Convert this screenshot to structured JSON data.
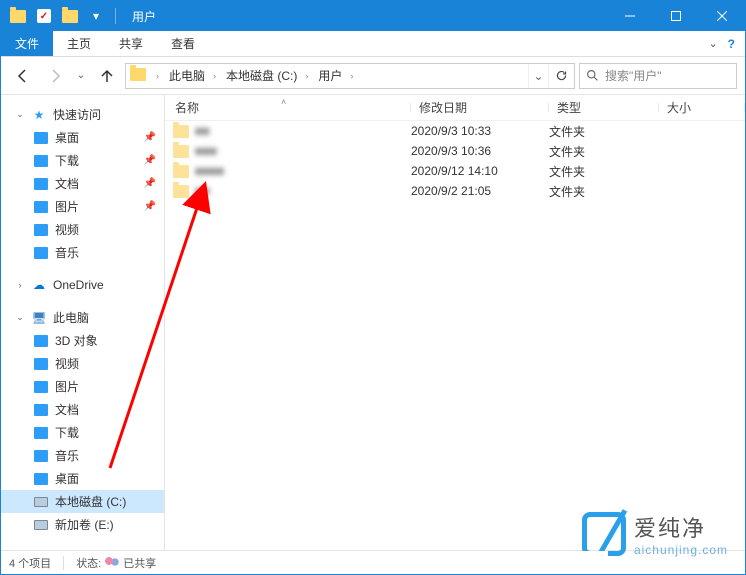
{
  "window": {
    "title": "用户"
  },
  "ribbon": {
    "file": "文件",
    "tabs": [
      "主页",
      "共享",
      "查看"
    ]
  },
  "breadcrumb": {
    "segments": [
      "此电脑",
      "本地磁盘 (C:)",
      "用户"
    ]
  },
  "search": {
    "placeholder": "搜索\"用户\""
  },
  "sidebar": {
    "quick_access": {
      "label": "快速访问",
      "items": [
        {
          "label": "桌面",
          "pinned": true
        },
        {
          "label": "下载",
          "pinned": true
        },
        {
          "label": "文档",
          "pinned": true
        },
        {
          "label": "图片",
          "pinned": true
        },
        {
          "label": "视频",
          "pinned": false
        },
        {
          "label": "音乐",
          "pinned": false
        }
      ]
    },
    "onedrive": {
      "label": "OneDrive"
    },
    "this_pc": {
      "label": "此电脑",
      "items": [
        {
          "label": "3D 对象"
        },
        {
          "label": "视频"
        },
        {
          "label": "图片"
        },
        {
          "label": "文档"
        },
        {
          "label": "下载"
        },
        {
          "label": "音乐"
        },
        {
          "label": "桌面"
        },
        {
          "label": "本地磁盘 (C:)",
          "selected": true
        },
        {
          "label": "新加卷 (E:)"
        }
      ]
    }
  },
  "columns": {
    "name": "名称",
    "date": "修改日期",
    "type": "类型",
    "size": "大小"
  },
  "rows": [
    {
      "name": "■■",
      "date": "2020/9/3 10:33",
      "type": "文件夹"
    },
    {
      "name": "■■■",
      "date": "2020/9/3 10:36",
      "type": "文件夹"
    },
    {
      "name": "■■■■",
      "date": "2020/9/12 14:10",
      "type": "文件夹"
    },
    {
      "name": "■■",
      "date": "2020/9/2 21:05",
      "type": "文件夹"
    }
  ],
  "statusbar": {
    "count": "4 个项目",
    "state_label": "状态:",
    "state_value": "已共享"
  },
  "watermark": {
    "cn": "爱纯净",
    "en": "aichunjing.com"
  }
}
